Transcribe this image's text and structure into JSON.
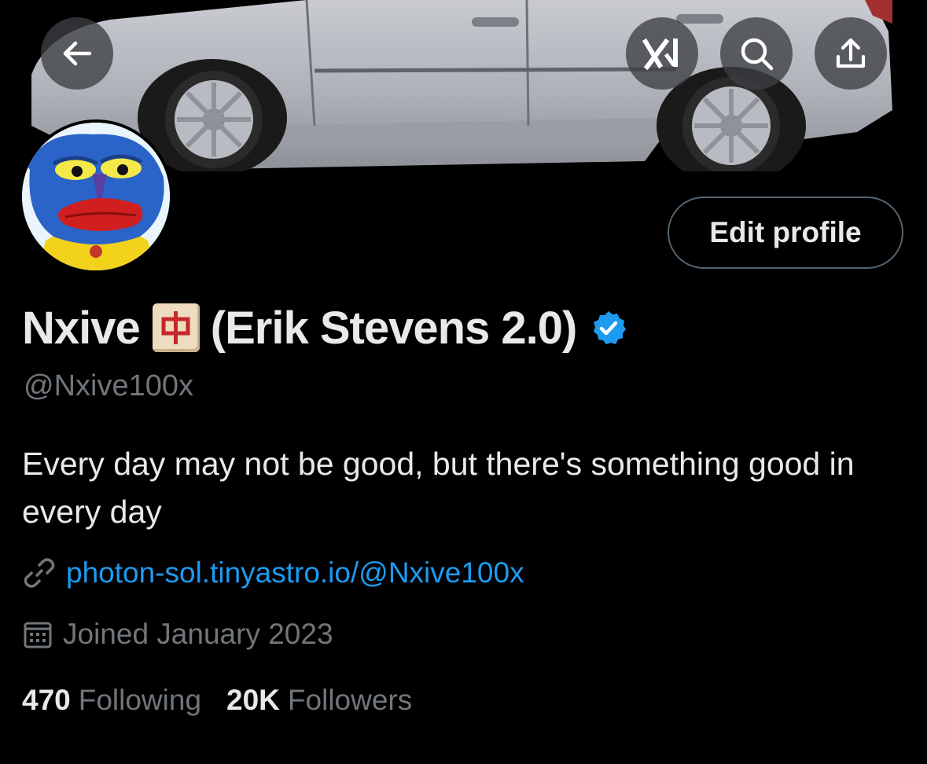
{
  "header": {
    "back_icon": "arrow-left-icon",
    "grok_icon": "grok-icon",
    "search_icon": "search-icon",
    "share_icon": "share-icon"
  },
  "profile": {
    "display_name": "Nxive",
    "name_emoji": "🀄",
    "name_suffix": "(Erik Stevens 2.0)",
    "verified": true,
    "handle": "@Nxive100x",
    "edit_label": "Edit profile",
    "bio": "Every day may not be good, but there's something good in every day",
    "link_text": "photon-sol.tinyastro.io/@Nxive100x",
    "joined_text": "Joined January 2023"
  },
  "stats": {
    "following_count": "470",
    "following_label": "Following",
    "followers_count": "20K",
    "followers_label": "Followers"
  },
  "colors": {
    "background": "#000000",
    "text": "#e7e9ea",
    "muted": "#71767b",
    "link": "#1d9bf0",
    "verified": "#1d9bf0"
  }
}
